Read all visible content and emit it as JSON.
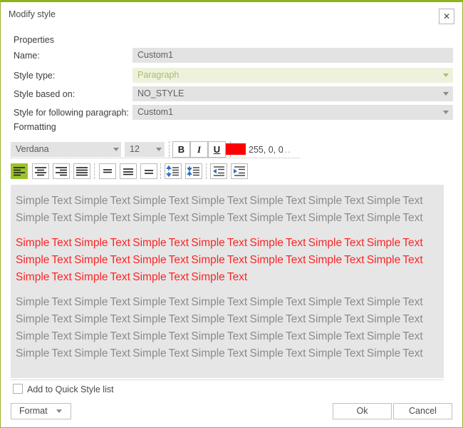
{
  "window": {
    "title": "Modify style",
    "close_icon": "close-icon",
    "accent_color": "#8db318",
    "border_color": "#9ab42a"
  },
  "properties": {
    "section_label": "Properties",
    "fields": [
      {
        "label": "Name:",
        "value": "Custom1",
        "has_dropdown": false,
        "highlighted": false
      },
      {
        "label": "Style type:",
        "value": "Paragraph",
        "has_dropdown": true,
        "highlighted": true
      },
      {
        "label": "Style based on:",
        "value": "NO_STYLE",
        "has_dropdown": true,
        "highlighted": false
      },
      {
        "label": "Style for following paragraph:",
        "value": "Custom1",
        "has_dropdown": true,
        "highlighted": false
      }
    ]
  },
  "formatting": {
    "section_label": "Formatting",
    "font_family": "Verdana",
    "font_size": "12",
    "bold_label": "B",
    "italic_label": "I",
    "underline_label": "U",
    "color_value": "255, 0, 0",
    "color_hex": "#ff0000",
    "more_label": "...",
    "align_buttons": [
      {
        "name": "align-left-button",
        "active": true
      },
      {
        "name": "align-center-button",
        "active": false
      },
      {
        "name": "align-right-button",
        "active": false
      },
      {
        "name": "align-justify-button",
        "active": false
      }
    ],
    "vertical_align_buttons": [
      {
        "name": "valign-top-button"
      },
      {
        "name": "valign-middle-button"
      },
      {
        "name": "valign-bottom-button"
      }
    ],
    "line_spacing_buttons": [
      {
        "name": "line-spacing-increase-button"
      },
      {
        "name": "line-spacing-decrease-button"
      }
    ],
    "indent_buttons": [
      {
        "name": "decrease-indent-button"
      },
      {
        "name": "increase-indent-button"
      }
    ]
  },
  "preview": {
    "sample_word": "Simple Text ",
    "blocks": [
      {
        "color": "gray",
        "repeats": 14
      },
      {
        "color": "red",
        "repeats": 18
      },
      {
        "color": "gray",
        "repeats": 28
      }
    ],
    "colors": {
      "gray": "#8b8b8b",
      "red": "#fc2424"
    },
    "background": "#e6e6e6"
  },
  "footer": {
    "checkbox_label": "Add to Quick Style list",
    "checkbox_checked": false,
    "format_label": "Format",
    "ok_label": "Ok",
    "cancel_label": "Cancel"
  }
}
